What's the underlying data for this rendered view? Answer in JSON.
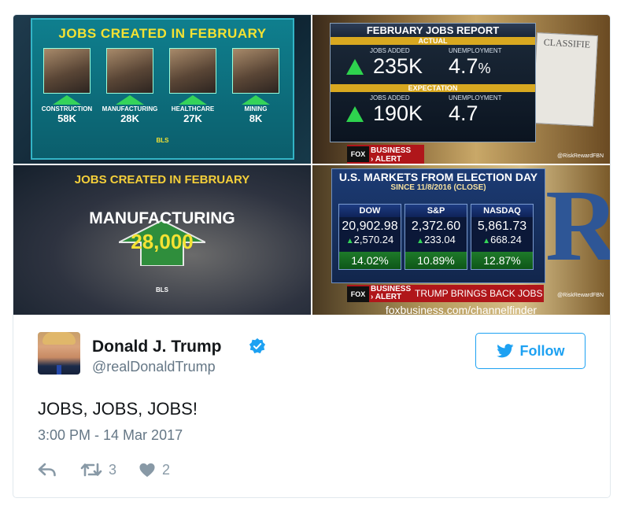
{
  "media": {
    "panel1": {
      "title": "JOBS CREATED IN FEBRUARY",
      "items": [
        {
          "category": "CONSTRUCTION",
          "value": "58K"
        },
        {
          "category": "MANUFACTURING",
          "value": "28K"
        },
        {
          "category": "HEALTHCARE",
          "value": "27K"
        },
        {
          "category": "MINING",
          "value": "8K"
        }
      ],
      "source": "BLS"
    },
    "panel2": {
      "title": "FEBRUARY JOBS REPORT",
      "actual_label": "ACTUAL",
      "expectation_label": "EXPECTATION",
      "jobs_added_label": "JOBS ADDED",
      "unemployment_label": "UNEMPLOYMENT",
      "actual_jobs": "235K",
      "actual_unemployment": "4.7",
      "actual_unemployment_unit": "%",
      "expected_jobs": "190K",
      "expected_unemployment": "4.7",
      "classified_text": "CLASSIFIE",
      "alert_line1": "BUSINESS",
      "alert_line2": "› ALERT",
      "fox_logo": "FOX",
      "handle": "@RiskRewardFBN"
    },
    "panel3": {
      "title": "JOBS CREATED IN FEBRUARY",
      "category": "MANUFACTURING",
      "value": "28,000",
      "source": "BLS"
    },
    "panel4": {
      "title": "U.S. MARKETS FROM ELECTION DAY",
      "subtitle": "SINCE 11/8/2016 (CLOSE)",
      "markets": [
        {
          "name": "DOW",
          "value": "20,902.98",
          "change": "2,570.24",
          "pct": "14.02%"
        },
        {
          "name": "S&P",
          "value": "2,372.60",
          "change": "233.04",
          "pct": "10.89%"
        },
        {
          "name": "NASDAQ",
          "value": "5,861.73",
          "change": "668.24",
          "pct": "12.87%"
        }
      ],
      "alert_line1": "BUSINESS",
      "alert_line2": "› ALERT",
      "headline": "TRUMP BRINGS BACK JOBS",
      "handle": "@RiskRewardFBN",
      "fox_logo": "FOX",
      "url": "foxbusiness.com/channelfinder"
    }
  },
  "user": {
    "name": "Donald J. Trump",
    "handle": "@realDonaldTrump"
  },
  "follow_label": "Follow",
  "tweet": {
    "text": "JOBS, JOBS, JOBS!",
    "timestamp": "3:00 PM - 14 Mar 2017",
    "retweets": "3",
    "likes": "2"
  },
  "colors": {
    "twitter_blue": "#1da1f2",
    "muted": "#8899a6",
    "up_green": "#2ed34e"
  }
}
